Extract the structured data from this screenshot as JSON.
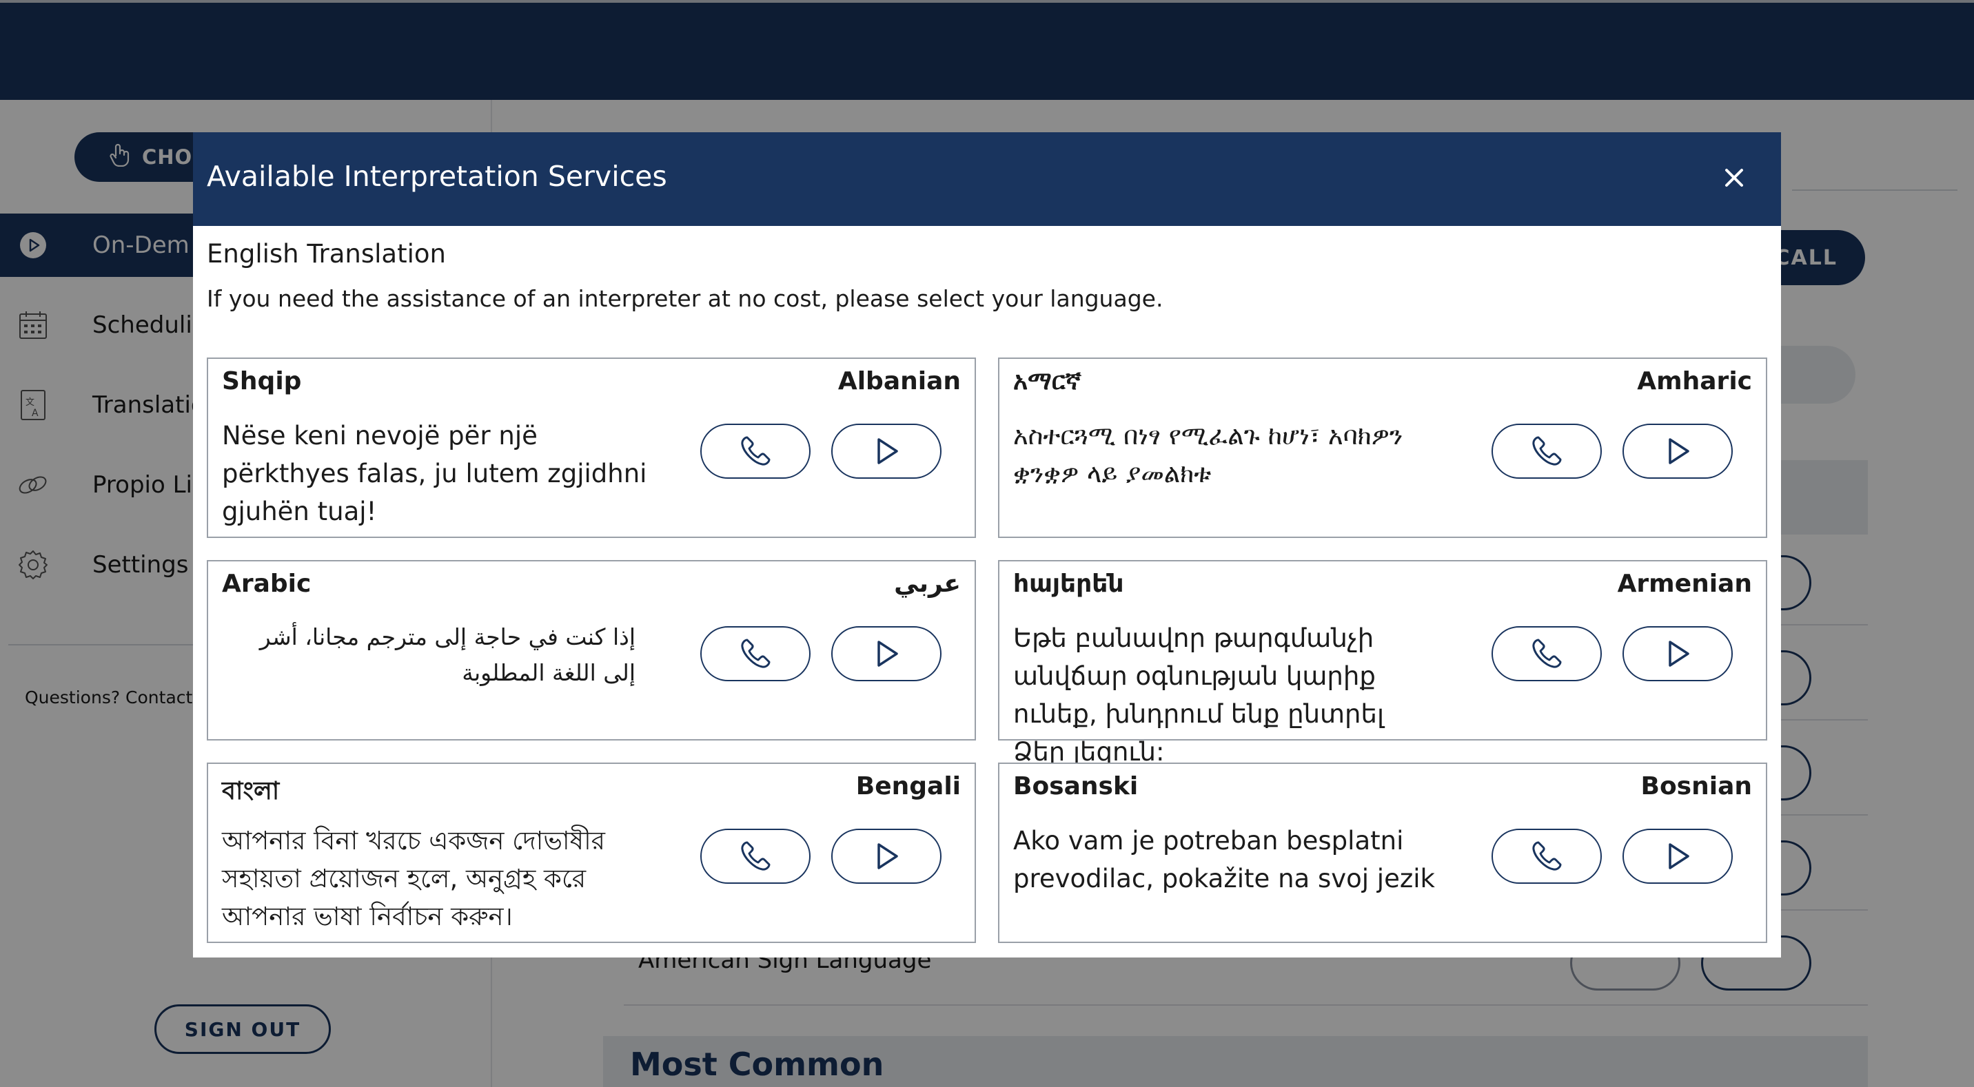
{
  "background": {
    "choose_button": "CHOO",
    "nav": [
      {
        "label": "On-Dem",
        "icon": "play-circle-icon",
        "active": true
      },
      {
        "label": "Schedulin",
        "icon": "calendar-icon",
        "active": false
      },
      {
        "label": "Translatio",
        "icon": "translate-document-icon",
        "active": false
      },
      {
        "label": "Propio Lin",
        "icon": "link-icon",
        "active": false
      },
      {
        "label": "Settings",
        "icon": "gear-icon",
        "active": false
      }
    ],
    "questions_text": "Questions? Contact y",
    "sign_out": "SIGN OUT",
    "call_label": "CALL",
    "asl_label": "American Sign Language",
    "most_common": "Most Common"
  },
  "modal": {
    "title": "Available Interpretation Services",
    "close_icon": "close-icon",
    "subtitle": "English Translation",
    "instruction": "If you need the assistance of an interpreter at no cost, please select your language.",
    "languages": [
      {
        "native": "Shqip",
        "english": "Albanian",
        "message": "Nëse keni nevojë për një përkthyes falas, ju lutem zgjidhni gjuhën tuaj!",
        "rtl": false
      },
      {
        "native": "አማርኛ",
        "english": "Amharic",
        "message": "አስተርጓሚ በነፃ የሚፈልጉ ከሆነ፣ አባክዎን ቋንቋዎ ላይ ያመልክቱ",
        "rtl": false
      },
      {
        "native": "Arabic",
        "english": "عربي",
        "message": "إذا كنت في حاجة إلى مترجم مجانا، أشر إلى اللغة المطلوبة",
        "rtl": true
      },
      {
        "native": "հայերեն",
        "english": "Armenian",
        "message": "Եթե բանավոր թարգմանչի անվճար օգնության կարիք ունեք, խնդրում ենք ընտրել Ձեր լեզուն:",
        "rtl": false
      },
      {
        "native": "বাংলা",
        "english": "Bengali",
        "message": "আপনার বিনা খরচে একজন দোভাষীর সহায়তা প্রয়োজন হলে, অনুগ্রহ করে আপনার ভাষা নির্বাচন করুন।",
        "rtl": false
      },
      {
        "native": "Bosanski",
        "english": "Bosnian",
        "message": "Ako vam je potreban besplatni prevodilac, pokažite na svoj jezik",
        "rtl": false
      }
    ],
    "phone_icon": "phone-icon",
    "play_icon": "play-icon"
  }
}
